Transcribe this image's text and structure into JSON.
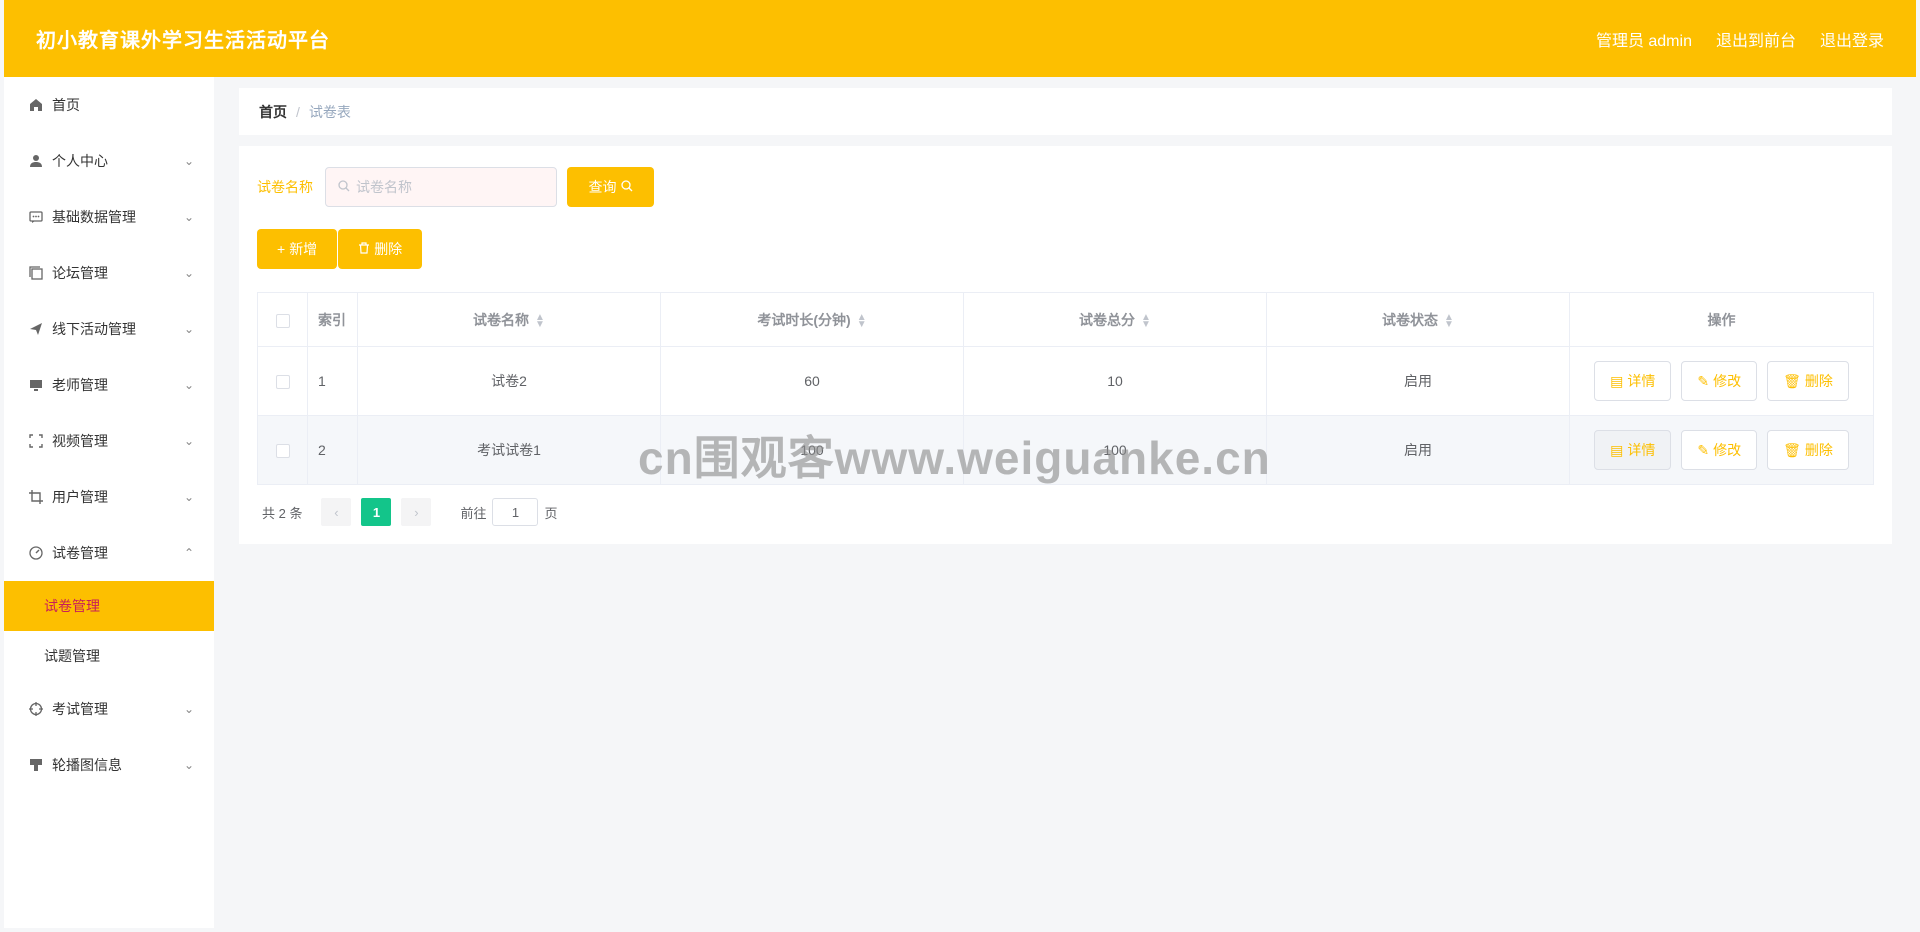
{
  "header": {
    "title": "初小教育课外学习生活活动平台",
    "user": "管理员 admin",
    "to_front": "退出到前台",
    "logout": "退出登录"
  },
  "sidebar": {
    "items": [
      {
        "label": "首页",
        "icon": "home-icon",
        "has_chevron": false
      },
      {
        "label": "个人中心",
        "icon": "user-icon",
        "has_chevron": true
      },
      {
        "label": "基础数据管理",
        "icon": "chat-icon",
        "has_chevron": true
      },
      {
        "label": "论坛管理",
        "icon": "copy-icon",
        "has_chevron": true
      },
      {
        "label": "线下活动管理",
        "icon": "send-icon",
        "has_chevron": true
      },
      {
        "label": "老师管理",
        "icon": "monitor-icon",
        "has_chevron": true
      },
      {
        "label": "视频管理",
        "icon": "fullscreen-icon",
        "has_chevron": true
      },
      {
        "label": "用户管理",
        "icon": "crop-icon",
        "has_chevron": true
      },
      {
        "label": "试卷管理",
        "icon": "speedometer-icon",
        "has_chevron": true,
        "expanded": true
      },
      {
        "label": "考试管理",
        "icon": "aim-icon",
        "has_chevron": true
      },
      {
        "label": "轮播图信息",
        "icon": "brush-icon",
        "has_chevron": true
      }
    ],
    "submenu": [
      {
        "label": "试卷管理",
        "active": true
      },
      {
        "label": "试题管理",
        "active": false
      }
    ]
  },
  "breadcrumb": {
    "home": "首页",
    "separator": "/",
    "current": "试卷表"
  },
  "search": {
    "label": "试卷名称",
    "placeholder": "试卷名称",
    "button": "查询"
  },
  "actions": {
    "add": "新增",
    "delete": "删除"
  },
  "table": {
    "columns": [
      "索引",
      "试卷名称",
      "考试时长(分钟)",
      "试卷总分",
      "试卷状态",
      "操作"
    ],
    "rows": [
      {
        "index": "1",
        "name": "试卷2",
        "duration": "60",
        "score": "10",
        "status": "启用"
      },
      {
        "index": "2",
        "name": "考试试卷1",
        "duration": "100",
        "score": "100",
        "status": "启用"
      }
    ],
    "row_actions": {
      "detail": "详情",
      "edit": "修改",
      "delete": "删除"
    }
  },
  "pagination": {
    "total": "共 2 条",
    "current_page": "1",
    "goto_prefix": "前往",
    "goto_value": "1",
    "goto_suffix": "页"
  },
  "watermark": "cn围观客www.weiguanke.cn",
  "colors": {
    "accent": "#fdbf00",
    "active_page": "#13c58a",
    "active_submenu_text": "#c81e5a"
  }
}
